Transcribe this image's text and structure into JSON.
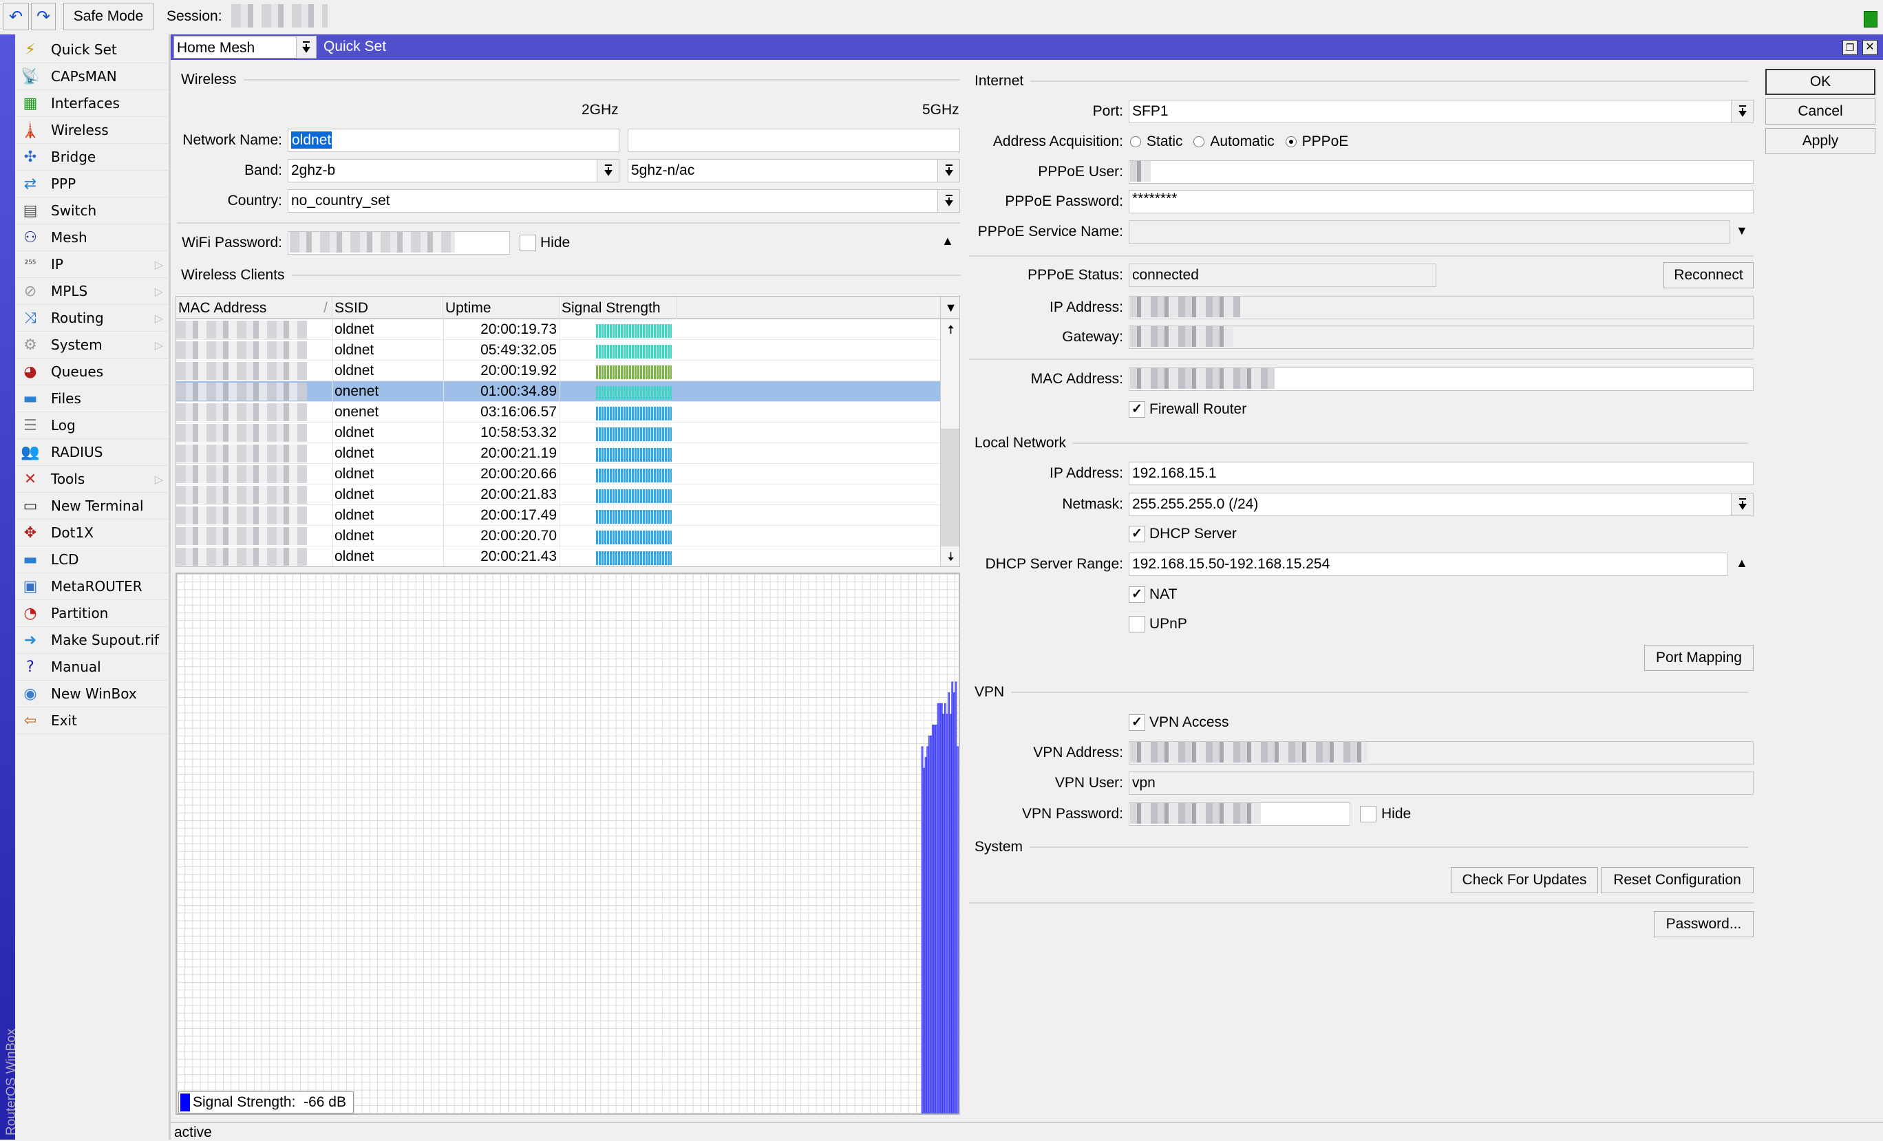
{
  "toolbar": {
    "safe_mode": "Safe Mode",
    "session_label": "Session:"
  },
  "brand_vertical": "RouterOS WinBox",
  "sidebar": {
    "items": [
      {
        "label": "Quick Set",
        "icon": "wand-icon",
        "glyph": "⚡",
        "color": "#c9a000"
      },
      {
        "label": "CAPsMAN",
        "icon": "antenna-icon",
        "glyph": "📡",
        "color": "#888"
      },
      {
        "label": "Interfaces",
        "icon": "network-card-icon",
        "glyph": "▦",
        "color": "#1a9a1a"
      },
      {
        "label": "Wireless",
        "icon": "antenna-icon",
        "glyph": "🗼",
        "color": "#888"
      },
      {
        "label": "Bridge",
        "icon": "bridge-icon",
        "glyph": "✣",
        "color": "#2a6acc"
      },
      {
        "label": "PPP",
        "icon": "ppp-icon",
        "glyph": "⇄",
        "color": "#2a80d0"
      },
      {
        "label": "Switch",
        "icon": "switch-icon",
        "glyph": "▤",
        "color": "#555"
      },
      {
        "label": "Mesh",
        "icon": "mesh-icon",
        "glyph": "⚇",
        "color": "#1a2a8a"
      },
      {
        "label": "IP",
        "icon": "ip-icon",
        "glyph": "²⁵⁵",
        "color": "#333",
        "sub": true
      },
      {
        "label": "MPLS",
        "icon": "mpls-icon",
        "glyph": "⊘",
        "color": "#999",
        "sub": true
      },
      {
        "label": "Routing",
        "icon": "routing-icon",
        "glyph": "⤨",
        "color": "#2a70d0",
        "sub": true
      },
      {
        "label": "System",
        "icon": "gear-icon",
        "glyph": "⚙",
        "color": "#999",
        "sub": true
      },
      {
        "label": "Queues",
        "icon": "queues-icon",
        "glyph": "◕",
        "color": "#b02020"
      },
      {
        "label": "Files",
        "icon": "folder-icon",
        "glyph": "▬",
        "color": "#2a80d0"
      },
      {
        "label": "Log",
        "icon": "log-icon",
        "glyph": "☰",
        "color": "#888"
      },
      {
        "label": "RADIUS",
        "icon": "users-icon",
        "glyph": "👥",
        "color": "#2a60c0"
      },
      {
        "label": "Tools",
        "icon": "tools-icon",
        "glyph": "✕",
        "color": "#c03030",
        "sub": true
      },
      {
        "label": "New Terminal",
        "icon": "terminal-icon",
        "glyph": "▭",
        "color": "#333"
      },
      {
        "label": "Dot1X",
        "icon": "dot1x-icon",
        "glyph": "✥",
        "color": "#b02020"
      },
      {
        "label": "LCD",
        "icon": "lcd-icon",
        "glyph": "▬",
        "color": "#2a80d0"
      },
      {
        "label": "MetaROUTER",
        "icon": "metarouter-icon",
        "glyph": "▣",
        "color": "#3a70c0"
      },
      {
        "label": "Partition",
        "icon": "partition-icon",
        "glyph": "◔",
        "color": "#c02020"
      },
      {
        "label": "Make Supout.rif",
        "icon": "file-arrow-icon",
        "glyph": "➜",
        "color": "#2a90d0"
      },
      {
        "label": "Manual",
        "icon": "help-book-icon",
        "glyph": "?",
        "color": "#1a1a9a"
      },
      {
        "label": "New WinBox",
        "icon": "winbox-icon",
        "glyph": "◉",
        "color": "#3a80d0"
      },
      {
        "label": "Exit",
        "icon": "exit-icon",
        "glyph": "⇦",
        "color": "#b86a30"
      }
    ]
  },
  "window": {
    "mode_select": "Home Mesh",
    "title": "Quick Set",
    "status": "active"
  },
  "buttons": {
    "ok": "OK",
    "cancel": "Cancel",
    "apply": "Apply"
  },
  "wireless": {
    "title": "Wireless",
    "col_2g": "2GHz",
    "col_5g": "5GHz",
    "network_name_label": "Network Name:",
    "network_name_2g": "oldnet",
    "network_name_5g": "",
    "band_label": "Band:",
    "band_2g": "2ghz-b",
    "band_5g": "5ghz-n/ac",
    "country_label": "Country:",
    "country": "no_country_set",
    "wifi_password_label": "WiFi Password:",
    "hide_label": "Hide",
    "hide_checked": false
  },
  "clients": {
    "title": "Wireless Clients",
    "columns": [
      "MAC Address",
      "SSID",
      "Uptime",
      "Signal Strength"
    ],
    "rows": [
      {
        "ssid": "oldnet",
        "uptime": "20:00:19.73",
        "signal_color": "#3fd6c4"
      },
      {
        "ssid": "oldnet",
        "uptime": "05:49:32.05",
        "signal_color": "#3fd6c4"
      },
      {
        "ssid": "oldnet",
        "uptime": "20:00:19.92",
        "signal_color": "#7fb34a"
      },
      {
        "ssid": "onenet",
        "uptime": "01:00:34.89",
        "signal_color": "#3fd6c4",
        "selected": true
      },
      {
        "ssid": "onenet",
        "uptime": "03:16:06.57",
        "signal_color": "#2fa8e6"
      },
      {
        "ssid": "oldnet",
        "uptime": "10:58:53.32",
        "signal_color": "#2fa8e6"
      },
      {
        "ssid": "oldnet",
        "uptime": "20:00:21.19",
        "signal_color": "#2fa8e6"
      },
      {
        "ssid": "oldnet",
        "uptime": "20:00:20.66",
        "signal_color": "#2fa8e6"
      },
      {
        "ssid": "oldnet",
        "uptime": "20:00:21.83",
        "signal_color": "#2fa8e6"
      },
      {
        "ssid": "oldnet",
        "uptime": "20:00:17.49",
        "signal_color": "#2fa8e6"
      },
      {
        "ssid": "oldnet",
        "uptime": "20:00:20.70",
        "signal_color": "#2fa8e6"
      },
      {
        "ssid": "oldnet",
        "uptime": "20:00:21.43",
        "signal_color": "#2fa8e6"
      }
    ]
  },
  "graph": {
    "legend": "Signal Strength:  -66 dB",
    "color": "#3a3aff",
    "bar_levels": [
      0.68,
      0.64,
      0.66,
      0.68,
      0.7,
      0.7,
      0.72,
      0.72,
      0.72,
      0.76,
      0.76,
      0.76,
      0.74,
      0.76,
      0.74,
      0.78,
      0.74,
      0.8,
      0.78,
      0.8,
      0.68
    ]
  },
  "internet": {
    "title": "Internet",
    "port_label": "Port:",
    "port": "SFP1",
    "acq_label": "Address Acquisition:",
    "acq_options": [
      "Static",
      "Automatic",
      "PPPoE"
    ],
    "acq_selected": "PPPoE",
    "pppoe_user_label": "PPPoE User:",
    "pppoe_password_label": "PPPoE Password:",
    "pppoe_password": "********",
    "service_name_label": "PPPoE Service Name:",
    "service_name": "",
    "status_label": "PPPoE Status:",
    "status": "connected",
    "reconnect": "Reconnect",
    "ip_label": "IP Address:",
    "gateway_label": "Gateway:",
    "mac_label": "MAC Address:",
    "firewall_label": "Firewall Router",
    "firewall_checked": true
  },
  "local": {
    "title": "Local Network",
    "ip_label": "IP Address:",
    "ip": "192.168.15.1",
    "netmask_label": "Netmask:",
    "netmask": "255.255.255.0 (/24)",
    "dhcp_label": "DHCP Server",
    "dhcp_checked": true,
    "range_label": "DHCP Server Range:",
    "range": "192.168.15.50-192.168.15.254",
    "nat_label": "NAT",
    "nat_checked": true,
    "upnp_label": "UPnP",
    "upnp_checked": false,
    "port_mapping": "Port Mapping"
  },
  "vpn": {
    "title": "VPN",
    "access_label": "VPN Access",
    "access_checked": true,
    "address_label": "VPN Address:",
    "user_label": "VPN User:",
    "user": "vpn",
    "password_label": "VPN Password:",
    "hide_label": "Hide"
  },
  "system": {
    "title": "System",
    "check_updates": "Check For Updates",
    "reset": "Reset Configuration",
    "password": "Password..."
  }
}
